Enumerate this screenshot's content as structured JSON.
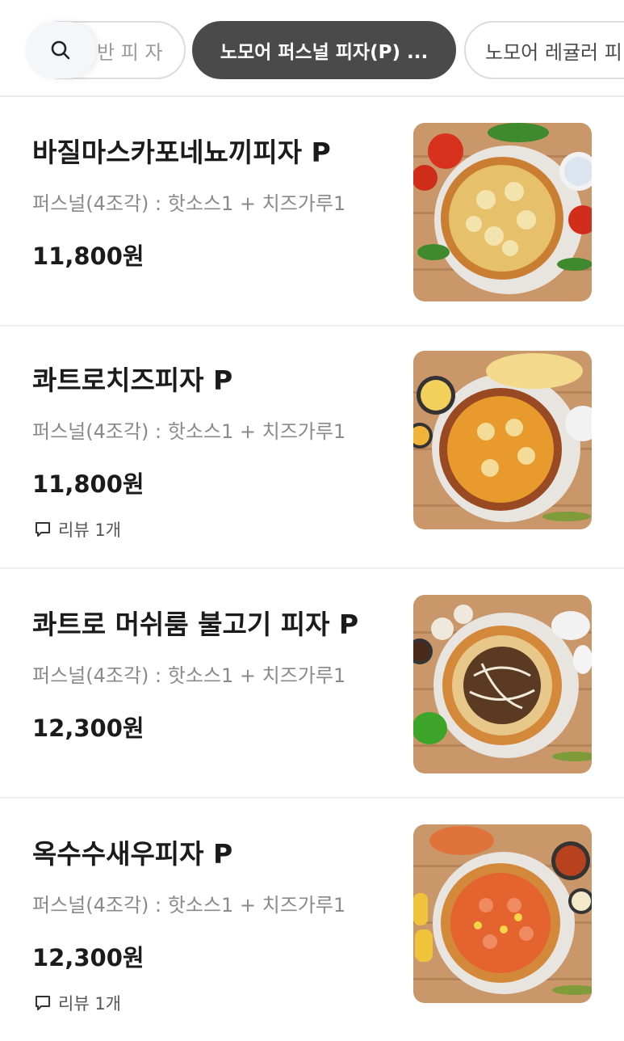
{
  "category_tabs": {
    "prev_label": "반 피 자",
    "active_label": "노모어 퍼스널 피자(P) ...",
    "next_label": "노모어 레귤러 피"
  },
  "search_icon": "search-icon",
  "menu_items": [
    {
      "name": "바질마스카포네뇨끼피자 P",
      "description": "퍼스널(4조각) : 핫소스1 + 치즈가루1",
      "price": "11,800원",
      "review": ""
    },
    {
      "name": "콰트로치즈피자 P",
      "description": "퍼스널(4조각) : 핫소스1 + 치즈가루1",
      "price": "11,800원",
      "review": "리뷰 1개"
    },
    {
      "name": "콰트로 머쉬룸 불고기 피자 P",
      "description": "퍼스널(4조각) : 핫소스1 + 치즈가루1",
      "price": "12,300원",
      "review": ""
    },
    {
      "name": "옥수수새우피자 P",
      "description": "퍼스널(4조각) : 핫소스1 + 치즈가루1",
      "price": "12,300원",
      "review": "리뷰 1개"
    }
  ],
  "colors": {
    "active_chip": "#4a4a4a",
    "wood": "#b98a5e",
    "crust": "#d9953f"
  }
}
